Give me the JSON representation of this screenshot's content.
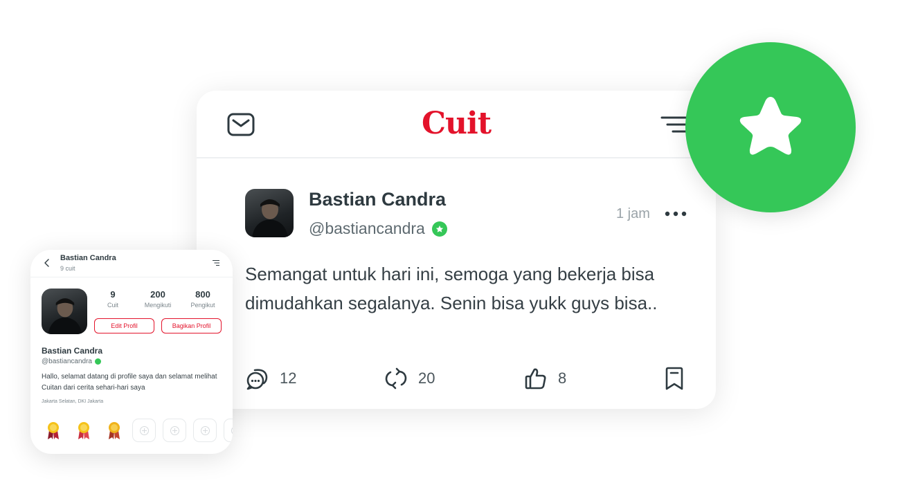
{
  "post": {
    "logo": "Cuit",
    "author_name": "Bastian Candra",
    "author_handle": "@bastiancandra",
    "time": "1 jam",
    "text": "Semangat untuk hari ini, semoga yang bekerja bisa dimudahkan segalanya. Senin bisa yukk guys bisa..",
    "actions": {
      "comments": "12",
      "retweets": "20",
      "likes": "8"
    },
    "icons": [
      "mail-icon",
      "menu-icon",
      "more-icon",
      "comment-icon",
      "repost-icon",
      "like-icon",
      "bookmark-icon"
    ]
  },
  "badge": {
    "icon": "star-icon",
    "color": "#35C758"
  },
  "profile": {
    "header_name": "Bastian Candra",
    "header_sub": "9 cuit",
    "stats": [
      {
        "value": "9",
        "label": "Cuit"
      },
      {
        "value": "200",
        "label": "Mengikuti"
      },
      {
        "value": "800",
        "label": "Pengikut"
      }
    ],
    "edit_button": "Edit Profil",
    "share_button": "Bagikan Profil",
    "name": "Bastian Candra",
    "handle": "@bastiancandra",
    "bio": "Hallo, selamat datang di profile saya dan selamat melihat Cuitan dari cerita sehari-hari saya",
    "location": "Jakarta Selatan, DKI Jakarta",
    "achievements": [
      "medal-icon",
      "medal-icon",
      "medal-icon",
      "empty-slot",
      "empty-slot",
      "empty-slot",
      "empty-slot"
    ]
  },
  "colors": {
    "brand": "#E3132B",
    "verified": "#35C758",
    "text": "#2E3A40"
  }
}
